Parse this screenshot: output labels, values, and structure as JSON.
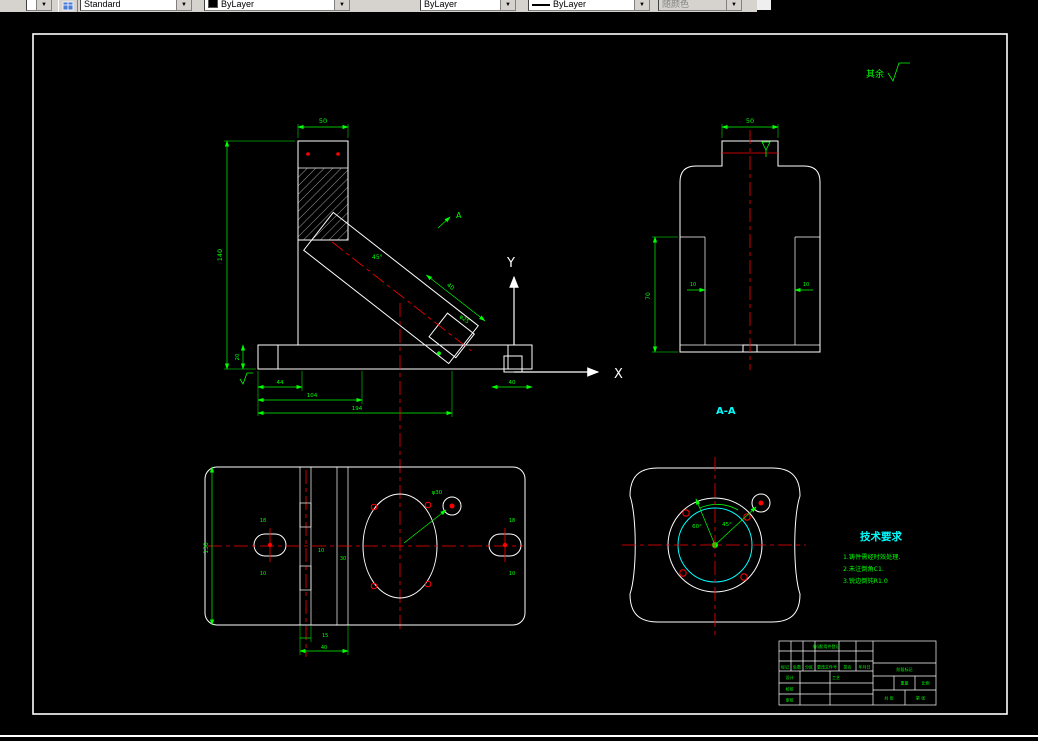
{
  "toolbar": {
    "mini_combo": "",
    "style_combo": "Standard",
    "color_combo": "ByLayer",
    "linetype_combo": "ByLayer",
    "lineweight_combo": "ByLayer",
    "plotstyle_combo": "随颜色"
  },
  "colors": {
    "dimension": "#00ff00",
    "centerline": "#ff0000",
    "outline": "#ffffff",
    "section_label": "#00ffff",
    "background": "#000000"
  },
  "annotations": {
    "surface_note": "其余",
    "section_label": "A-A",
    "axis_x": "X",
    "axis_y": "Y",
    "cut_a": "A"
  },
  "tech": {
    "title": "技术要求",
    "items": [
      "1.铸件需经时效处理.",
      "2.未注倒角C1.",
      "3.锐边倒钝R1.0"
    ]
  },
  "dims": {
    "front_top_width": "50",
    "front_height": "140",
    "front_base_height": "20",
    "front_bottom_a": "44",
    "front_bottom_b": "104",
    "front_bottom_c": "194",
    "front_bottom_right": "40",
    "front_angle": "45°",
    "front_boss_len": "40",
    "front_boss_dia": "φ25",
    "side_top_width": "50",
    "side_height": "70",
    "side_wall_left": "10",
    "side_wall_right": "10",
    "plan_height": "130",
    "plan_slot_left_a": "18",
    "plan_slot_left_b": "10",
    "plan_mid_a": "10",
    "plan_mid_b": "30",
    "plan_bottom_a": "15",
    "plan_bottom_b": "40",
    "plan_slot_right_a": "18",
    "plan_slot_right_b": "10",
    "plan_hole_dia": "φ30",
    "sec_angle_a": "45°",
    "sec_angle_b": "60°"
  },
  "titleblock": {
    "borrow": "借(通)用件登记",
    "mark": "标记",
    "count": "处数",
    "zone": "分区",
    "doc": "更改文件号",
    "sign": "签名",
    "date": "年月日",
    "design": "设计",
    "check": "校核",
    "approve": "审核",
    "craft": "工艺",
    "stage": "阶段标记",
    "weight": "重量",
    "scale": "比例",
    "sheets": "共 张",
    "sheet": "第 张"
  }
}
